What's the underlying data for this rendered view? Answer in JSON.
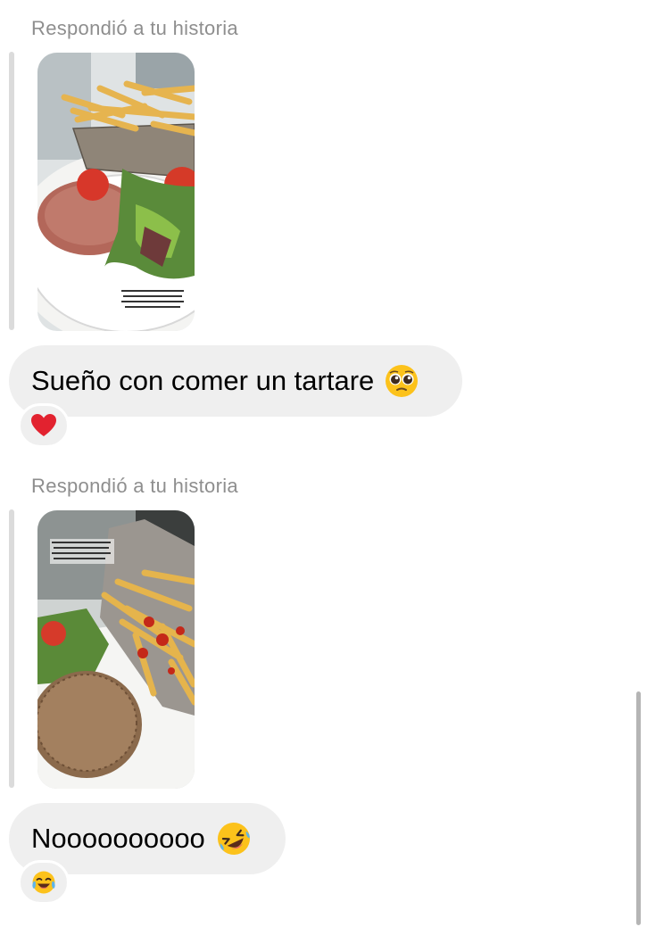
{
  "messages": [
    {
      "reply_caption": "Respondió a tu historia",
      "story_image": "steak-tartare-with-fries-photo",
      "text": "Sueño con comer un tartare",
      "emoji": "pleading-face",
      "reaction": "red-heart"
    },
    {
      "reply_caption": "Respondió a tu historia",
      "story_image": "burger-patty-with-fries-photo",
      "text": "Noooooooooo",
      "emoji": "rolling-on-floor-laughing-face",
      "reaction": "tears-of-joy-face"
    }
  ],
  "colors": {
    "bubble": "#efefef",
    "caption": "#8e8e8e",
    "reply_line": "#dbdbdb",
    "scrollbar": "#b5b5b5"
  }
}
